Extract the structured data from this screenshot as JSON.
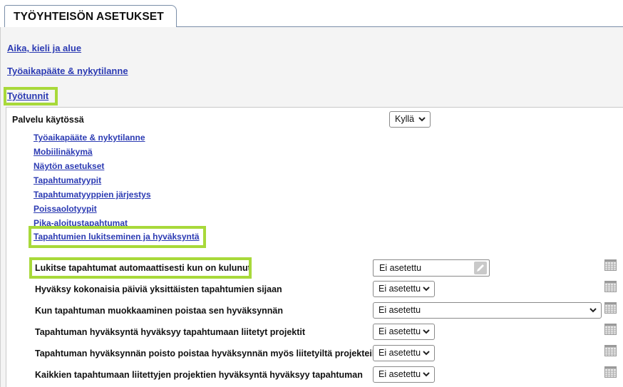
{
  "tab": {
    "title": "TYÖYHTEISÖN ASETUKSET"
  },
  "nav": {
    "time_language_region": "Aika, kieli ja alue",
    "terminal_status": "Työaikapääte & nykytilanne",
    "work_hours": "Työtunnit"
  },
  "service": {
    "label": "Palvelu käytössä",
    "value": "Kyllä"
  },
  "sublinks": [
    "Työaikapääte & nykytilanne",
    "Mobiilinäkymä",
    "Näytön asetukset",
    "Tapahtumatyypit",
    "Tapahtumatyyppien järjestys",
    "Poissaolotyypit",
    "Pika-aloitustapahtumat",
    "Tapahtumien lukitseminen ja hyväksyntä"
  ],
  "settings": [
    {
      "label": "Lukitse tapahtumat automaattisesti kun on kulunut",
      "value": "Ei asetettu"
    },
    {
      "label": "Hyväksy kokonaisia päiviä yksittäisten tapahtumien sijaan",
      "value": "Ei asetettu"
    },
    {
      "label": "Kun tapahtuman muokkaaminen poistaa sen hyväksynnän",
      "value": "Ei asetettu"
    },
    {
      "label": "Tapahtuman hyväksyntä hyväksyy tapahtumaan liitetyt projektit",
      "value": "Ei asetettu"
    },
    {
      "label": "Tapahtuman hyväksynnän poisto poistaa hyväksynnän myös liitetyiltä projekteilta",
      "value": "Ei asetettu"
    },
    {
      "label": "Kaikkien tapahtumaan liitettyjen projektien hyväksyntä hyväksyy tapahtuman",
      "value": "Ei asetettu"
    }
  ],
  "icons": {
    "dropdown": "chevron-down-icon",
    "edit": "pencil-icon",
    "calendar": "calendar-icon"
  },
  "colors": {
    "link": "#2c3bb3",
    "highlight": "#a8d93a",
    "panel_bg": "#f4f4f4"
  }
}
